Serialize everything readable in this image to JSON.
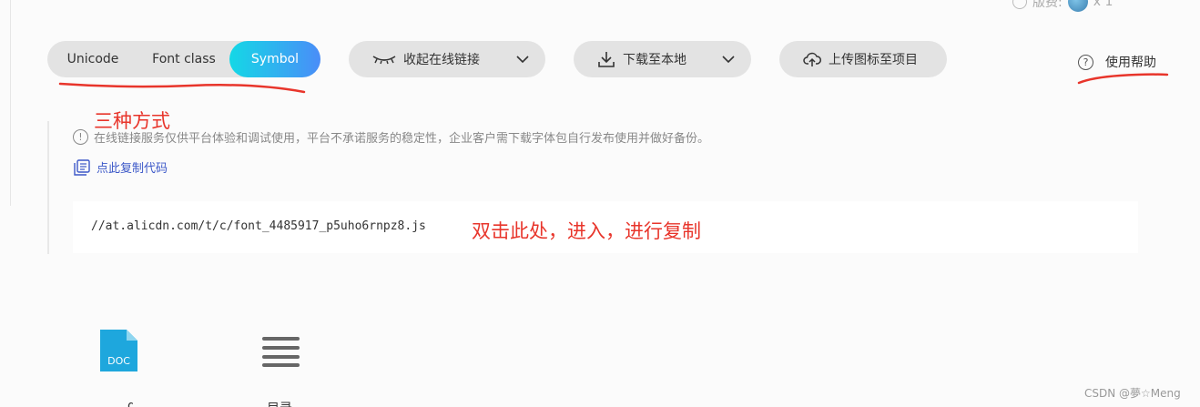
{
  "top_user": {
    "label": "版费:",
    "count": "x 1"
  },
  "tabs": {
    "unicode": "Unicode",
    "font_class": "Font class",
    "symbol": "Symbol"
  },
  "actions": {
    "collapse_link": "收起在线链接",
    "download_local": "下载至本地",
    "upload_project": "上传图标至项目"
  },
  "help": {
    "label": "使用帮助",
    "icon_glyph": "?"
  },
  "annotations": {
    "three_ways": "三种方式",
    "double_click": "双击此处，进入，进行复制"
  },
  "notice": {
    "icon_glyph": "!",
    "text": "在线链接服务仅供平台体验和调试使用，平台不承诺服务的稳定性，企业客户需下载字体包自行发布使用并做好备份。"
  },
  "copy_code": {
    "label": "点此复制代码"
  },
  "code": {
    "url": "//at.alicdn.com/t/c/font_4485917_p5uho6rnpz8.js"
  },
  "icons": {
    "doc_label": "DOC",
    "item1_label": "doc",
    "item2_label": "目录"
  },
  "watermark": "CSDN @夢☆Meng",
  "colors": {
    "accent_start": "#14d8e6",
    "accent_end": "#4a8df8",
    "annotation": "#e8352b",
    "link": "#3c58c8",
    "doc_blue": "#1ea7dd"
  }
}
